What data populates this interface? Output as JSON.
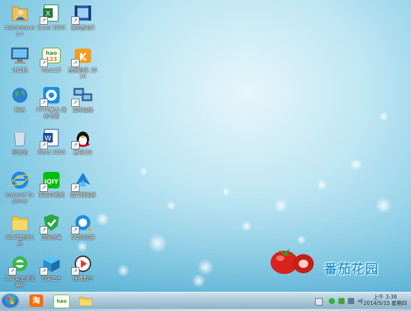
{
  "desktop": {
    "icons": [
      {
        "label": "Administrato r",
        "icon": "user-folder-icon",
        "shortcut": false
      },
      {
        "label": "Excel 2003",
        "icon": "excel-icon",
        "shortcut": true
      },
      {
        "label": "暴风影音5",
        "icon": "baofeng-player-icon",
        "shortcut": true
      },
      {
        "label": "计算机",
        "icon": "computer-icon",
        "shortcut": false
      },
      {
        "label": "hao123",
        "icon": "hao123-icon",
        "shortcut": true
      },
      {
        "label": "酷我音乐 2014",
        "icon": "kuwo-music-icon",
        "shortcut": true
      },
      {
        "label": "网络",
        "icon": "network-globe-icon",
        "shortcut": false
      },
      {
        "label": "PPTV聚力 网络电视",
        "icon": "pptv-icon",
        "shortcut": true
      },
      {
        "label": "宽带连接",
        "icon": "broadband-connection-icon",
        "shortcut": true
      },
      {
        "label": "回收站",
        "icon": "recycle-bin-icon",
        "shortcut": false
      },
      {
        "label": "Word 2003",
        "icon": "word-icon",
        "shortcut": true
      },
      {
        "label": "腾讯QQ",
        "icon": "qq-penguin-icon",
        "shortcut": true
      },
      {
        "label": "Internet Explorer",
        "icon": "internet-explorer-icon",
        "shortcut": false
      },
      {
        "label": "爱奇艺视频",
        "icon": "iqiyi-icon",
        "shortcut": true
      },
      {
        "label": "迅雷精简版",
        "icon": "xunlei-icon",
        "shortcut": true
      },
      {
        "label": "WIN7激活工 具",
        "icon": "folder-icon",
        "shortcut": false
      },
      {
        "label": "百度杀毒",
        "icon": "baidu-antivirus-icon",
        "shortcut": true
      },
      {
        "label": "QQ浏览器",
        "icon": "qq-browser-icon",
        "shortcut": true
      },
      {
        "label": "360安全浏览 器6",
        "icon": "360-browser-icon",
        "shortcut": true
      },
      {
        "label": "百度卫士",
        "icon": "baidu-guard-icon",
        "shortcut": true
      },
      {
        "label": "快播影音",
        "icon": "qvod-player-icon",
        "shortcut": true
      }
    ],
    "brand": "番茄花园"
  },
  "taskbar": {
    "pinned": [
      {
        "name": "taobao",
        "label": "淘",
        "icon": "taobao-icon"
      },
      {
        "name": "hao123",
        "label": "hao",
        "icon": "hao123-icon"
      },
      {
        "name": "explorer",
        "label": "",
        "icon": "folder-icon"
      }
    ],
    "clock": {
      "time": "上午 3:38",
      "date": "2014/5/15 星期四"
    }
  },
  "colors": {
    "accent": "#2a9bd6",
    "taskbar": "#a9c7d8"
  }
}
